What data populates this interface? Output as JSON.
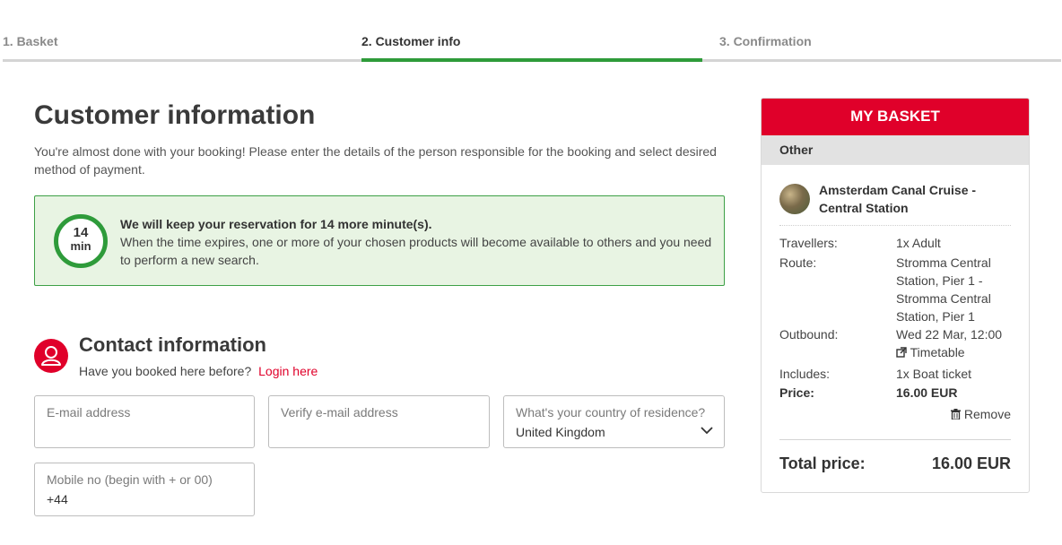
{
  "steps": [
    {
      "label": "1. Basket"
    },
    {
      "label": "2. Customer info"
    },
    {
      "label": "3. Confirmation"
    }
  ],
  "main": {
    "title": "Customer information",
    "intro": "You're almost done with your booking! Please enter the details of the person responsible for the booking and select desired method of payment.",
    "timer": {
      "minutes": "14",
      "unit": "min",
      "headline": "We will keep your reservation for 14 more minute(s).",
      "body": "When the time expires, one or more of your chosen products will become available to others and you need to perform a new search."
    },
    "contact": {
      "title": "Contact information",
      "question": "Have you booked here before?",
      "login_link": "Login here"
    },
    "form": {
      "email_placeholder": "E-mail address",
      "verify_placeholder": "Verify e-mail address",
      "country_label": "What's your country of residence?",
      "country_value": "United Kingdom",
      "mobile_label": "Mobile no (begin with + or 00)",
      "mobile_value": "+44"
    }
  },
  "basket": {
    "title": "MY BASKET",
    "category": "Other",
    "product_name": "Amsterdam Canal Cruise - Central Station",
    "travellers_label": "Travellers:",
    "travellers_value": "1x Adult",
    "route_label": "Route:",
    "route_value": "Stromma Central Station, Pier 1 - Stromma Central Station, Pier 1",
    "outbound_label": "Outbound:",
    "outbound_value": "Wed 22 Mar, 12:00",
    "timetable_link": "Timetable",
    "includes_label": "Includes:",
    "includes_value": "1x Boat ticket",
    "price_label": "Price:",
    "price_value": "16.00 EUR",
    "remove_label": "Remove",
    "total_label": "Total price:",
    "total_value": "16.00 EUR"
  },
  "colors": {
    "accent_red": "#e0002a",
    "success_green": "#2e9b3a",
    "timer_bg": "#e8f4e3"
  }
}
